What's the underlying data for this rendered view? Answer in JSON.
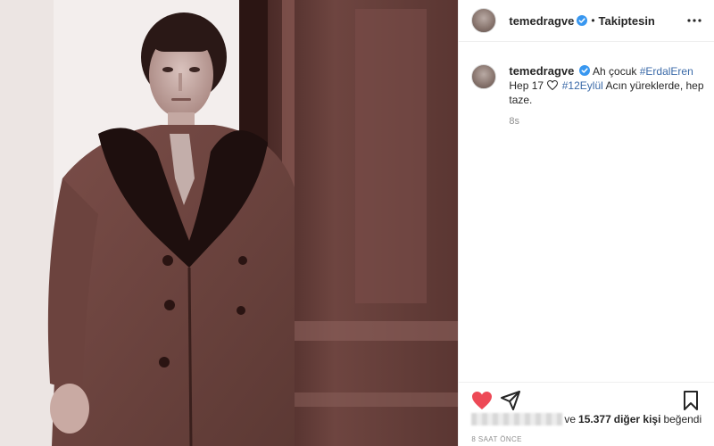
{
  "header": {
    "username": "temedragve",
    "follow_status": "Takiptesin",
    "separator": "•"
  },
  "caption": {
    "username": "temedragve",
    "text_1": "Ah çocuk",
    "hashtag_1": "#ErdalEren",
    "text_2": "Hep 17",
    "hashtag_2": "#12Eylül",
    "text_3": "Acın yüreklerde, hep taze.",
    "time_ago": "8s"
  },
  "likes": {
    "prefix": "ve",
    "count": "15.377",
    "others_label": "diğer kişi",
    "suffix": "beğendi"
  },
  "post_date": "8 SAAT ÖNCE",
  "colors": {
    "like_red": "#ed4956",
    "verified_blue": "#3897f0",
    "hashtag_blue": "#3b6aa8"
  },
  "icons": [
    "verified-icon",
    "more-options-icon",
    "heart-icon",
    "share-icon",
    "bookmark-icon"
  ]
}
